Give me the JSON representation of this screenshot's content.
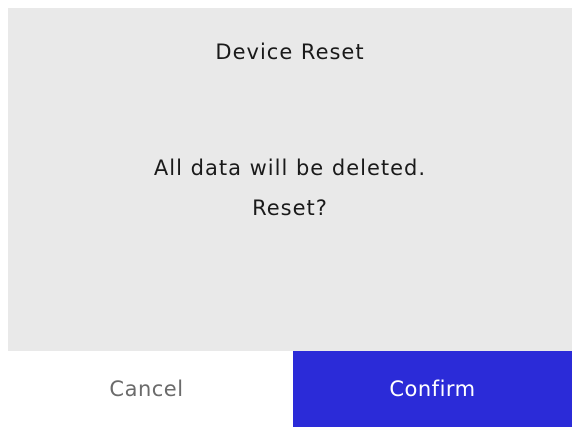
{
  "dialog": {
    "title": "Device Reset",
    "message_line1": "All data will be deleted.",
    "message_line2": "Reset?"
  },
  "buttons": {
    "cancel_label": "Cancel",
    "confirm_label": "Confirm"
  },
  "colors": {
    "panel_background": "#e9e9e9",
    "confirm_background": "#2b2bd8",
    "cancel_text": "#6b6b6b"
  }
}
